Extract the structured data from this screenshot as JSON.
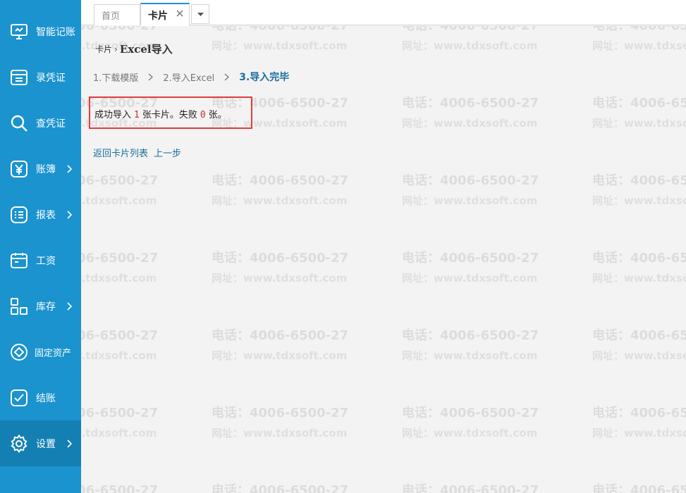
{
  "sidebar": {
    "accent": "#1a93cf",
    "items": [
      {
        "label": "智能记账",
        "icon": "monitor-icon",
        "has_submenu": false
      },
      {
        "label": "录凭证",
        "icon": "voucher-entry-icon",
        "has_submenu": false
      },
      {
        "label": "查凭证",
        "icon": "search-icon",
        "has_submenu": false
      },
      {
        "label": "账簿",
        "icon": "yen-icon",
        "has_submenu": true
      },
      {
        "label": "报表",
        "icon": "report-list-icon",
        "has_submenu": true
      },
      {
        "label": "工资",
        "icon": "calendar-icon",
        "has_submenu": false
      },
      {
        "label": "库存",
        "icon": "grid-icon",
        "has_submenu": true
      },
      {
        "label": "固定资产",
        "icon": "diamond-icon",
        "has_submenu": false
      },
      {
        "label": "结账",
        "icon": "check-icon",
        "has_submenu": false
      },
      {
        "label": "设置",
        "icon": "gear-icon",
        "has_submenu": true,
        "active": true
      }
    ]
  },
  "tabs": {
    "home": "首页",
    "current": "卡片"
  },
  "breadcrumb": {
    "parent": "卡片",
    "separator": "›",
    "current": "Excel导入"
  },
  "steps": [
    {
      "label": "1.下载模版",
      "active": false
    },
    {
      "label": "2.导入Excel",
      "active": false
    },
    {
      "label": "3.导入完毕",
      "active": true
    }
  ],
  "result": {
    "prefix": "成功导入",
    "success_count": "1",
    "middle": "张卡片。失败",
    "fail_count": "0",
    "suffix": "张。",
    "highlight_color": "#e23b3b"
  },
  "actions": {
    "back_to_list": "返回卡片列表",
    "previous_step": "上一步"
  },
  "watermark": {
    "phone": "电话：4006-6500-27",
    "site": "网址：www.tdxsoft.com"
  }
}
